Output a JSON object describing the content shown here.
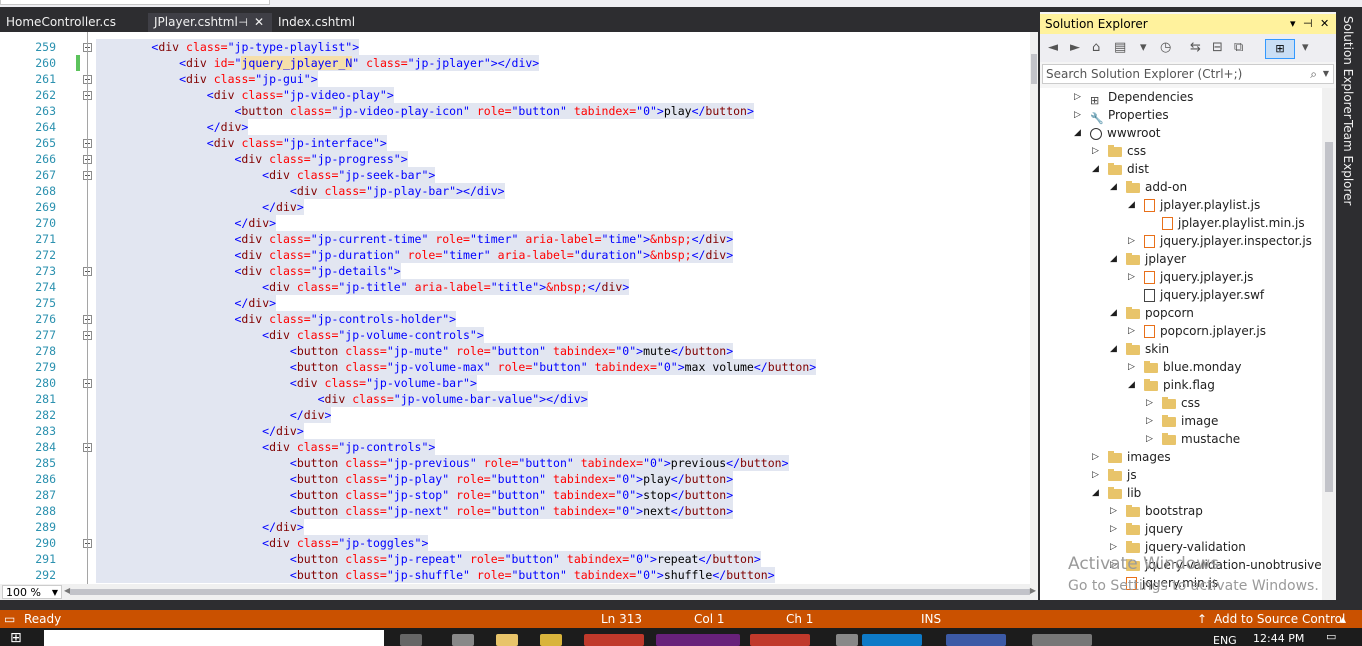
{
  "tabs": [
    {
      "label": "HomeController.cs",
      "active": false
    },
    {
      "label": "JPlayer.cshtml",
      "active": true,
      "pin": "⊣",
      "close": "✕"
    },
    {
      "label": "Index.cshtml",
      "active": false
    }
  ],
  "editor": {
    "lines": [
      {
        "n": "259"
      },
      {
        "n": "260"
      },
      {
        "n": "261"
      },
      {
        "n": "262"
      },
      {
        "n": "263"
      },
      {
        "n": "264"
      },
      {
        "n": "265"
      },
      {
        "n": "266"
      },
      {
        "n": "267"
      },
      {
        "n": "268"
      },
      {
        "n": "269"
      },
      {
        "n": "270"
      },
      {
        "n": "271"
      },
      {
        "n": "272"
      },
      {
        "n": "273"
      },
      {
        "n": "274"
      },
      {
        "n": "275"
      },
      {
        "n": "276"
      },
      {
        "n": "277"
      },
      {
        "n": "278"
      },
      {
        "n": "279"
      },
      {
        "n": "280"
      },
      {
        "n": "281"
      },
      {
        "n": "282"
      },
      {
        "n": "283"
      },
      {
        "n": "284"
      },
      {
        "n": "285"
      },
      {
        "n": "286"
      },
      {
        "n": "287"
      },
      {
        "n": "288"
      },
      {
        "n": "289"
      },
      {
        "n": "290"
      },
      {
        "n": "291"
      },
      {
        "n": "292"
      }
    ],
    "code": [
      [
        "        ",
        "<div ",
        "class=",
        "\"jp-type-playlist\"",
        ">"
      ],
      [
        "            ",
        "<div ",
        "id=",
        "\"jquery_jplayer_N\"",
        "class=",
        "\"jp-jplayer\"",
        "></div>"
      ],
      [
        "            ",
        "<div ",
        "class=",
        "\"jp-gui\"",
        ">"
      ],
      [
        "                ",
        "<div ",
        "class=",
        "\"jp-video-play\"",
        ">"
      ],
      [
        "                    ",
        "<button ",
        "class=",
        "\"jp-video-play-icon\"",
        "role=",
        "\"button\"",
        "tabindex=",
        "\"0\"",
        ">",
        "play",
        "</button>"
      ],
      [
        "                ",
        "</div>"
      ],
      [
        "                ",
        "<div ",
        "class=",
        "\"jp-interface\"",
        ">"
      ],
      [
        "                    ",
        "<div ",
        "class=",
        "\"jp-progress\"",
        ">"
      ],
      [
        "                        ",
        "<div ",
        "class=",
        "\"jp-seek-bar\"",
        ">"
      ],
      [
        "                            ",
        "<div ",
        "class=",
        "\"jp-play-bar\"",
        "></div>"
      ],
      [
        "                        ",
        "</div>"
      ],
      [
        "                    ",
        "</div>"
      ],
      [
        "                    ",
        "<div ",
        "class=",
        "\"jp-current-time\"",
        "role=",
        "\"timer\"",
        "aria-label=",
        "\"time\"",
        ">",
        "&nbsp;",
        "</div>"
      ],
      [
        "                    ",
        "<div ",
        "class=",
        "\"jp-duration\"",
        "role=",
        "\"timer\"",
        "aria-label=",
        "\"duration\"",
        ">",
        "&nbsp;",
        "</div>"
      ],
      [
        "                    ",
        "<div ",
        "class=",
        "\"jp-details\"",
        ">"
      ],
      [
        "                        ",
        "<div ",
        "class=",
        "\"jp-title\"",
        "aria-label=",
        "\"title\"",
        ">",
        "&nbsp;",
        "</div>"
      ],
      [
        "                    ",
        "</div>"
      ],
      [
        "                    ",
        "<div ",
        "class=",
        "\"jp-controls-holder\"",
        ">"
      ],
      [
        "                        ",
        "<div ",
        "class=",
        "\"jp-volume-controls\"",
        ">"
      ],
      [
        "                            ",
        "<button ",
        "class=",
        "\"jp-mute\"",
        "role=",
        "\"button\"",
        "tabindex=",
        "\"0\"",
        ">",
        "mute",
        "</button>"
      ],
      [
        "                            ",
        "<button ",
        "class=",
        "\"jp-volume-max\"",
        "role=",
        "\"button\"",
        "tabindex=",
        "\"0\"",
        ">",
        "max volume",
        "</button>"
      ],
      [
        "                            ",
        "<div ",
        "class=",
        "\"jp-volume-bar\"",
        ">"
      ],
      [
        "                                ",
        "<div ",
        "class=",
        "\"jp-volume-bar-value\"",
        "></div>"
      ],
      [
        "                            ",
        "</div>"
      ],
      [
        "                        ",
        "</div>"
      ],
      [
        "                        ",
        "<div ",
        "class=",
        "\"jp-controls\"",
        ">"
      ],
      [
        "                            ",
        "<button ",
        "class=",
        "\"jp-previous\"",
        "role=",
        "\"button\"",
        "tabindex=",
        "\"0\"",
        ">",
        "previous",
        "</button>"
      ],
      [
        "                            ",
        "<button ",
        "class=",
        "\"jp-play\"",
        "role=",
        "\"button\"",
        "tabindex=",
        "\"0\"",
        ">",
        "play",
        "</button>"
      ],
      [
        "                            ",
        "<button ",
        "class=",
        "\"jp-stop\"",
        "role=",
        "\"button\"",
        "tabindex=",
        "\"0\"",
        ">",
        "stop",
        "</button>"
      ],
      [
        "                            ",
        "<button ",
        "class=",
        "\"jp-next\"",
        "role=",
        "\"button\"",
        "tabindex=",
        "\"0\"",
        ">",
        "next",
        "</button>"
      ],
      [
        "                        ",
        "</div>"
      ],
      [
        "                        ",
        "<div ",
        "class=",
        "\"jp-toggles\"",
        ">"
      ],
      [
        "                            ",
        "<button ",
        "class=",
        "\"jp-repeat\"",
        "role=",
        "\"button\"",
        "tabindex=",
        "\"0\"",
        ">",
        "repeat",
        "</button>"
      ],
      [
        "                            ",
        "<button ",
        "class=",
        "\"jp-shuffle\"",
        "role=",
        "\"button\"",
        "tabindex=",
        "\"0\"",
        ">",
        "shuffle",
        "</button>"
      ]
    ],
    "zoom": "100 %"
  },
  "solution_explorer": {
    "title": "Solution Explorer",
    "search_placeholder": "Search Solution Explorer (Ctrl+;)",
    "tree": [
      {
        "label": "Dependencies",
        "icon": "dependencies-icon",
        "exp": "▷"
      },
      {
        "label": "Properties",
        "icon": "wrench-icon",
        "exp": "▷"
      },
      {
        "label": "wwwroot",
        "icon": "globe-icon",
        "exp": "◢"
      },
      {
        "label": "css",
        "icon": "folder-icon",
        "exp": "▷"
      },
      {
        "label": "dist",
        "icon": "folder-icon",
        "exp": "◢"
      },
      {
        "label": "add-on",
        "icon": "folder-icon",
        "exp": "◢"
      },
      {
        "label": "jplayer.playlist.js",
        "icon": "js-file-icon",
        "exp": "◢"
      },
      {
        "label": "jplayer.playlist.min.js",
        "icon": "js-file-icon",
        "exp": ""
      },
      {
        "label": "jquery.jplayer.inspector.js",
        "icon": "js-file-icon",
        "exp": "▷"
      },
      {
        "label": "jplayer",
        "icon": "folder-icon",
        "exp": "◢"
      },
      {
        "label": "jquery.jplayer.js",
        "icon": "js-file-icon",
        "exp": "▷"
      },
      {
        "label": "jquery.jplayer.swf",
        "icon": "file-icon",
        "exp": ""
      },
      {
        "label": "popcorn",
        "icon": "folder-icon",
        "exp": "◢"
      },
      {
        "label": "popcorn.jplayer.js",
        "icon": "js-file-icon",
        "exp": "▷"
      },
      {
        "label": "skin",
        "icon": "folder-icon",
        "exp": "◢"
      },
      {
        "label": "blue.monday",
        "icon": "folder-icon",
        "exp": "▷"
      },
      {
        "label": "pink.flag",
        "icon": "folder-icon",
        "exp": "◢"
      },
      {
        "label": "css",
        "icon": "folder-icon",
        "exp": "▷"
      },
      {
        "label": "image",
        "icon": "folder-icon",
        "exp": "▷"
      },
      {
        "label": "mustache",
        "icon": "folder-icon",
        "exp": "▷"
      },
      {
        "label": "images",
        "icon": "folder-icon",
        "exp": "▷"
      },
      {
        "label": "js",
        "icon": "folder-icon",
        "exp": "▷"
      },
      {
        "label": "lib",
        "icon": "folder-icon",
        "exp": "◢"
      },
      {
        "label": "bootstrap",
        "icon": "folder-icon",
        "exp": "▷"
      },
      {
        "label": "jquery",
        "icon": "folder-icon",
        "exp": "▷"
      },
      {
        "label": "jquery-validation",
        "icon": "folder-icon",
        "exp": "▷"
      },
      {
        "label": "jquery-validation-unobtrusive",
        "icon": "folder-icon",
        "exp": "▷"
      },
      {
        "label": "jquery.min.js",
        "icon": "js-file-icon",
        "exp": ""
      }
    ],
    "watermark_line1": "Activate Windows",
    "watermark_line2": "Go to Settings to activate Windows."
  },
  "side_tabs": [
    "Solution Explorer",
    "Team Explorer"
  ],
  "status": {
    "state": "Ready",
    "ln": "Ln 313",
    "col": "Col 1",
    "ch": "Ch 1",
    "mode": "INS",
    "source_control": "Add to Source Control"
  },
  "taskbar": {
    "lang": "ENG",
    "time": "12:44 PM"
  },
  "colors": {
    "status_bar": "#ca5100",
    "se_title_bg": "#fff29d",
    "selection": "#e2e6f1"
  }
}
